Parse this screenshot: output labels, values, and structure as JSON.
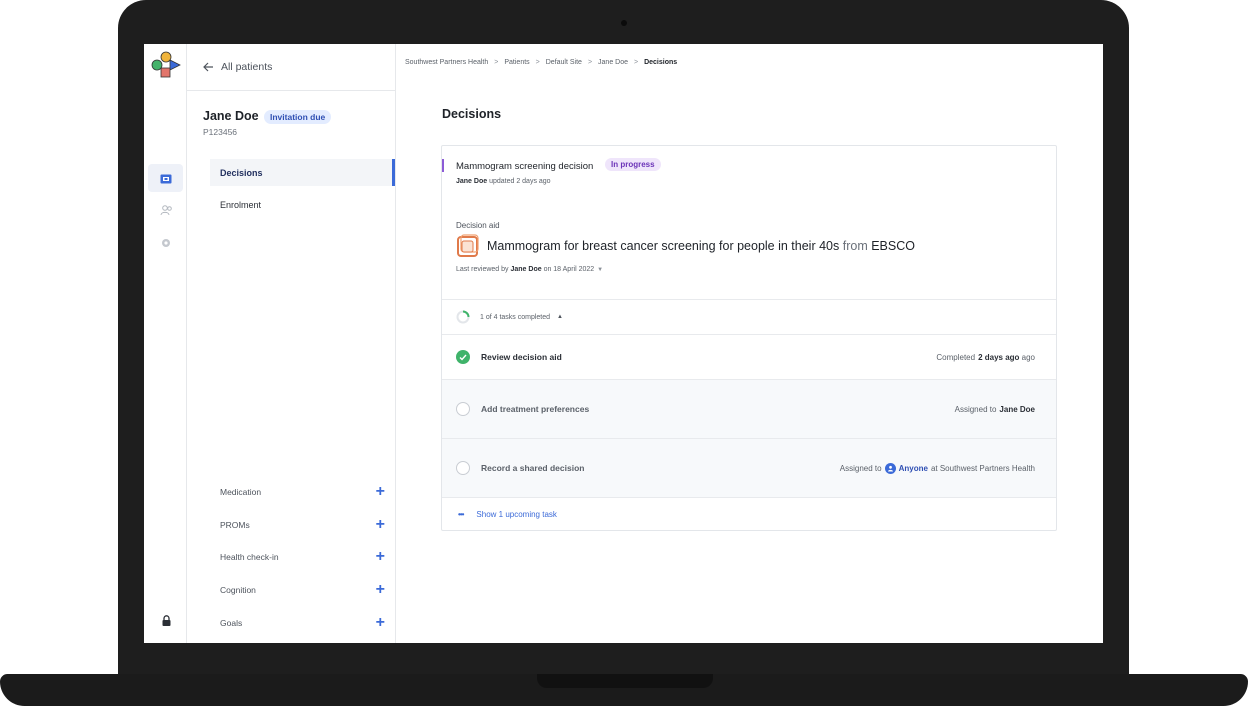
{
  "nav": {
    "back_label": "All patients",
    "items": [
      {
        "label": "Decisions",
        "active": true
      },
      {
        "label": "Enrolment",
        "active": false
      }
    ],
    "add_sections": [
      "Medication",
      "PROMs",
      "Health check-in",
      "Cognition",
      "Goals"
    ]
  },
  "patient": {
    "name": "Jane Doe",
    "status_badge": "Invitation due",
    "id": "P123456"
  },
  "breadcrumb": [
    "Southwest Partners Health",
    "Patients",
    "Default Site",
    "Jane Doe",
    "Decisions"
  ],
  "page_title": "Decisions",
  "decision": {
    "title": "Mammogram screening decision",
    "status": "In progress",
    "updated_by": "Jane Doe",
    "updated_text": "updated 2 days ago",
    "aid_label": "Decision aid",
    "aid_title": "Mammogram for breast cancer screening for people in their 40s",
    "aid_from": "from",
    "aid_source": "EBSCO",
    "reviewed_prefix": "Last reviewed by",
    "reviewed_by": "Jane Doe",
    "reviewed_date": "on 18 April 2022",
    "progress_text": "1 of 4 tasks completed",
    "progress_fraction": 0.25
  },
  "tasks": [
    {
      "name": "Review decision aid",
      "done": true,
      "meta_prefix": "Completed",
      "meta_value": "2 days ago"
    },
    {
      "name": "Add treatment preferences",
      "done": false,
      "meta_prefix": "Assigned to",
      "meta_value": "Jane Doe"
    },
    {
      "name": "Record a shared decision",
      "done": false,
      "meta_prefix": "Assigned to",
      "meta_value": "Anyone",
      "meta_suffix": "at Southwest Partners Health"
    }
  ],
  "upcoming_label": "Show 1 upcoming task",
  "colors": {
    "accent_blue": "#3b6ad8",
    "status_purple": "#8c5bd6",
    "done_green": "#3fb36a",
    "frame": "#1e1e1e"
  }
}
